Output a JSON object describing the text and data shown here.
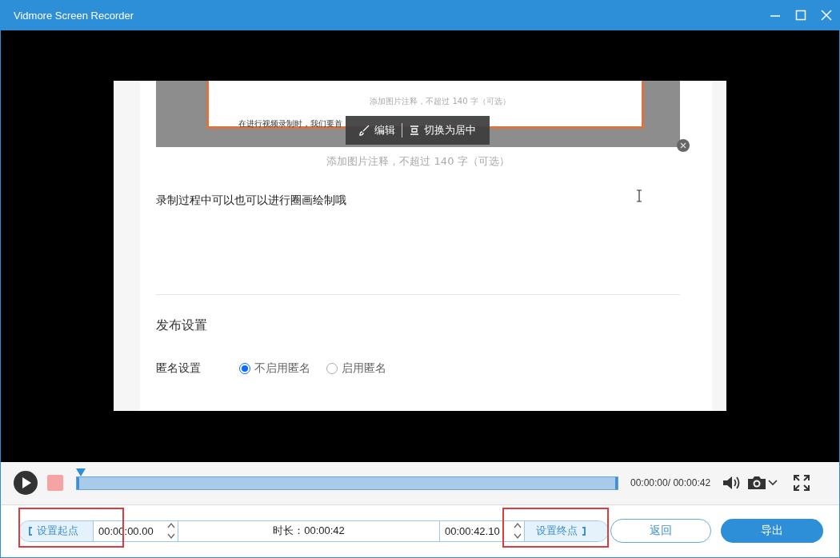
{
  "window": {
    "title": "Vidmore Screen Recorder"
  },
  "frame": {
    "inner_caption": "添加图片注释，不超过 140 字（可选）",
    "inner_paragraph": "在进行视频录制时，我们要首",
    "image_toolbar": [
      {
        "kind": "edit",
        "label": "编辑"
      },
      {
        "kind": "center",
        "label": "切换为居中"
      }
    ],
    "caption_placeholder": "添加图片注释，不超过 140 字（可选）",
    "body_text": "录制过程中可以也可以进行圈画绘制哦",
    "section_title": "发布设置",
    "anonymous": {
      "label": "匿名设置",
      "options": [
        {
          "label": "不启用匿名",
          "selected": true
        },
        {
          "label": "启用匿名",
          "selected": false
        }
      ]
    }
  },
  "player": {
    "playhead": {
      "level": 0
    },
    "time": "00:00:00/ 00:00:42"
  },
  "trim": {
    "start_button": "设置起点",
    "start_time": "00:00:00.00",
    "duration": "时长：00:00:42",
    "end_time": "00:00:42.10",
    "end_button": "设置终点"
  },
  "buttons": [
    {
      "label": "返回",
      "kind": "secondary"
    },
    {
      "label": "导出",
      "kind": "primary"
    }
  ]
}
